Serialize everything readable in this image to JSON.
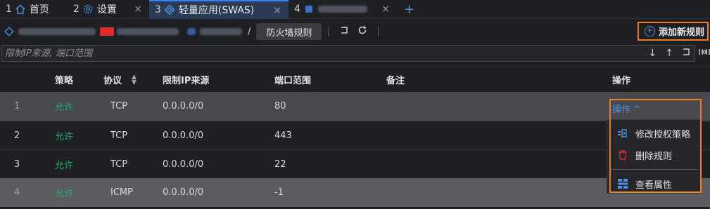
{
  "tabs": [
    {
      "num": "1",
      "label": "首页",
      "icon": "home-icon"
    },
    {
      "num": "2",
      "label": "设置",
      "icon": "gear-icon",
      "close": "×"
    },
    {
      "num": "3",
      "label": "轻量应用(SWAS)",
      "icon": "swas-icon",
      "close": "×"
    },
    {
      "num": "4",
      "label": "",
      "icon": "instance-icon",
      "close": "×"
    }
  ],
  "tab_add": "+",
  "toolbar": {
    "separator": "/",
    "current_tab": "防火墙规则",
    "add_rule_label": "添加新规则"
  },
  "filter": {
    "placeholder": "限制IP来源, 端口范围"
  },
  "table": {
    "headers": {
      "policy": "策略",
      "protocol": "协议",
      "ip": "限制IP来源",
      "port": "端口范围",
      "note": "备注",
      "op": "操作"
    },
    "rows": [
      {
        "num": "1",
        "policy": "允许",
        "protocol": "TCP",
        "ip": "0.0.0.0/0",
        "port": "80"
      },
      {
        "num": "2",
        "policy": "允许",
        "protocol": "TCP",
        "ip": "0.0.0.0/0",
        "port": "443"
      },
      {
        "num": "3",
        "policy": "允许",
        "protocol": "TCP",
        "ip": "0.0.0.0/0",
        "port": "22"
      },
      {
        "num": "4",
        "policy": "允许",
        "protocol": "ICMP",
        "ip": "0.0.0.0/0",
        "port": "-1"
      }
    ]
  },
  "op_menu": {
    "trigger": "操作 ^",
    "items": [
      {
        "label": "修改授权策略",
        "icon": "edit-policy-icon"
      },
      {
        "label": "删除规则",
        "icon": "trash-icon"
      },
      {
        "label": "查看属性",
        "icon": "grid-properties-icon"
      }
    ]
  },
  "colors": {
    "accent": "#4a90e2",
    "highlight": "#f07c1a",
    "allow": "#1fae6a",
    "delete": "#e5262a"
  }
}
